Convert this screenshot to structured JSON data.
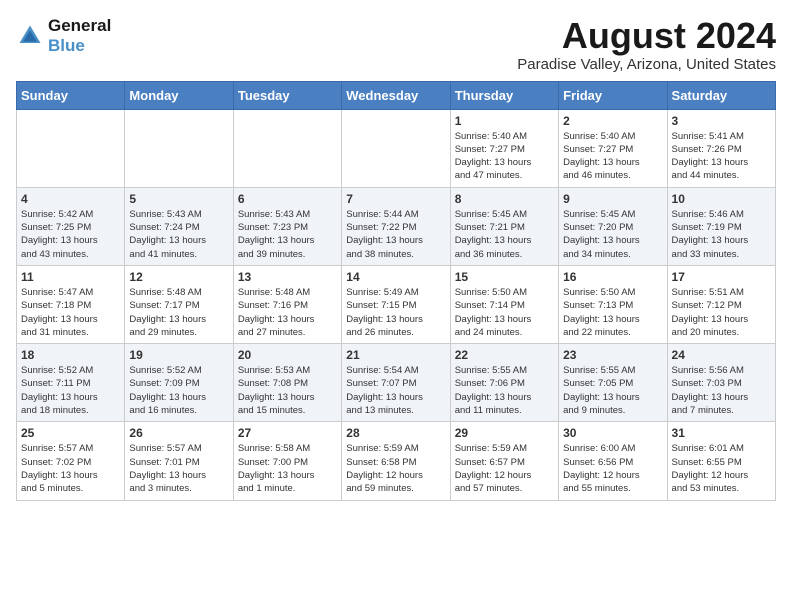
{
  "logo": {
    "line1": "General",
    "line2": "Blue"
  },
  "title": "August 2024",
  "location": "Paradise Valley, Arizona, United States",
  "days_of_week": [
    "Sunday",
    "Monday",
    "Tuesday",
    "Wednesday",
    "Thursday",
    "Friday",
    "Saturday"
  ],
  "weeks": [
    [
      {
        "day": "",
        "info": ""
      },
      {
        "day": "",
        "info": ""
      },
      {
        "day": "",
        "info": ""
      },
      {
        "day": "",
        "info": ""
      },
      {
        "day": "1",
        "info": "Sunrise: 5:40 AM\nSunset: 7:27 PM\nDaylight: 13 hours\nand 47 minutes."
      },
      {
        "day": "2",
        "info": "Sunrise: 5:40 AM\nSunset: 7:27 PM\nDaylight: 13 hours\nand 46 minutes."
      },
      {
        "day": "3",
        "info": "Sunrise: 5:41 AM\nSunset: 7:26 PM\nDaylight: 13 hours\nand 44 minutes."
      }
    ],
    [
      {
        "day": "4",
        "info": "Sunrise: 5:42 AM\nSunset: 7:25 PM\nDaylight: 13 hours\nand 43 minutes."
      },
      {
        "day": "5",
        "info": "Sunrise: 5:43 AM\nSunset: 7:24 PM\nDaylight: 13 hours\nand 41 minutes."
      },
      {
        "day": "6",
        "info": "Sunrise: 5:43 AM\nSunset: 7:23 PM\nDaylight: 13 hours\nand 39 minutes."
      },
      {
        "day": "7",
        "info": "Sunrise: 5:44 AM\nSunset: 7:22 PM\nDaylight: 13 hours\nand 38 minutes."
      },
      {
        "day": "8",
        "info": "Sunrise: 5:45 AM\nSunset: 7:21 PM\nDaylight: 13 hours\nand 36 minutes."
      },
      {
        "day": "9",
        "info": "Sunrise: 5:45 AM\nSunset: 7:20 PM\nDaylight: 13 hours\nand 34 minutes."
      },
      {
        "day": "10",
        "info": "Sunrise: 5:46 AM\nSunset: 7:19 PM\nDaylight: 13 hours\nand 33 minutes."
      }
    ],
    [
      {
        "day": "11",
        "info": "Sunrise: 5:47 AM\nSunset: 7:18 PM\nDaylight: 13 hours\nand 31 minutes."
      },
      {
        "day": "12",
        "info": "Sunrise: 5:48 AM\nSunset: 7:17 PM\nDaylight: 13 hours\nand 29 minutes."
      },
      {
        "day": "13",
        "info": "Sunrise: 5:48 AM\nSunset: 7:16 PM\nDaylight: 13 hours\nand 27 minutes."
      },
      {
        "day": "14",
        "info": "Sunrise: 5:49 AM\nSunset: 7:15 PM\nDaylight: 13 hours\nand 26 minutes."
      },
      {
        "day": "15",
        "info": "Sunrise: 5:50 AM\nSunset: 7:14 PM\nDaylight: 13 hours\nand 24 minutes."
      },
      {
        "day": "16",
        "info": "Sunrise: 5:50 AM\nSunset: 7:13 PM\nDaylight: 13 hours\nand 22 minutes."
      },
      {
        "day": "17",
        "info": "Sunrise: 5:51 AM\nSunset: 7:12 PM\nDaylight: 13 hours\nand 20 minutes."
      }
    ],
    [
      {
        "day": "18",
        "info": "Sunrise: 5:52 AM\nSunset: 7:11 PM\nDaylight: 13 hours\nand 18 minutes."
      },
      {
        "day": "19",
        "info": "Sunrise: 5:52 AM\nSunset: 7:09 PM\nDaylight: 13 hours\nand 16 minutes."
      },
      {
        "day": "20",
        "info": "Sunrise: 5:53 AM\nSunset: 7:08 PM\nDaylight: 13 hours\nand 15 minutes."
      },
      {
        "day": "21",
        "info": "Sunrise: 5:54 AM\nSunset: 7:07 PM\nDaylight: 13 hours\nand 13 minutes."
      },
      {
        "day": "22",
        "info": "Sunrise: 5:55 AM\nSunset: 7:06 PM\nDaylight: 13 hours\nand 11 minutes."
      },
      {
        "day": "23",
        "info": "Sunrise: 5:55 AM\nSunset: 7:05 PM\nDaylight: 13 hours\nand 9 minutes."
      },
      {
        "day": "24",
        "info": "Sunrise: 5:56 AM\nSunset: 7:03 PM\nDaylight: 13 hours\nand 7 minutes."
      }
    ],
    [
      {
        "day": "25",
        "info": "Sunrise: 5:57 AM\nSunset: 7:02 PM\nDaylight: 13 hours\nand 5 minutes."
      },
      {
        "day": "26",
        "info": "Sunrise: 5:57 AM\nSunset: 7:01 PM\nDaylight: 13 hours\nand 3 minutes."
      },
      {
        "day": "27",
        "info": "Sunrise: 5:58 AM\nSunset: 7:00 PM\nDaylight: 13 hours\nand 1 minute."
      },
      {
        "day": "28",
        "info": "Sunrise: 5:59 AM\nSunset: 6:58 PM\nDaylight: 12 hours\nand 59 minutes."
      },
      {
        "day": "29",
        "info": "Sunrise: 5:59 AM\nSunset: 6:57 PM\nDaylight: 12 hours\nand 57 minutes."
      },
      {
        "day": "30",
        "info": "Sunrise: 6:00 AM\nSunset: 6:56 PM\nDaylight: 12 hours\nand 55 minutes."
      },
      {
        "day": "31",
        "info": "Sunrise: 6:01 AM\nSunset: 6:55 PM\nDaylight: 12 hours\nand 53 minutes."
      }
    ]
  ]
}
